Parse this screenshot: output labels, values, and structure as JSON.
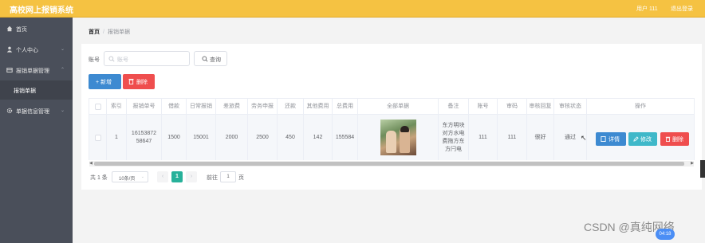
{
  "header": {
    "title": "高校网上报销系统",
    "user": "用户 111",
    "logout": "退出登录"
  },
  "sidebar": {
    "items": [
      {
        "label": "首页",
        "icon": "home-icon"
      },
      {
        "label": "个人中心",
        "icon": "user-icon"
      },
      {
        "label": "报销单据管理",
        "icon": "wallet-icon"
      },
      {
        "label": "报销单据",
        "sub": true
      },
      {
        "label": "单据信息管理",
        "icon": "gear-icon"
      }
    ]
  },
  "breadcrumb": {
    "home": "首页",
    "separator": "/",
    "current": "报销单据"
  },
  "search": {
    "label": "账号",
    "placeholder": "账号",
    "button": "查询"
  },
  "toolbar": {
    "add": "+ 新增",
    "delete": "删除"
  },
  "table": {
    "headers": [
      "索引",
      "报销单号",
      "借款",
      "日常报销",
      "差旅费",
      "劳务申报",
      "还款",
      "其他费用",
      "总费用",
      "全部单据",
      "备注",
      "账号",
      "审码",
      "审核回复",
      "审核状态",
      "操作"
    ],
    "rows": [
      {
        "index": "1",
        "number": "1615387258647",
        "loan": "1500",
        "daily": "15001",
        "travel": "2000",
        "labor": "2500",
        "repay": "450",
        "other": "142",
        "total": "155584",
        "remark": "东方明块对方水电费拖方东方闩电",
        "account": "111",
        "code": "111",
        "reply": "很好",
        "status": "通过"
      }
    ],
    "actions": {
      "detail": "详情",
      "edit": "修改",
      "delete": "删除"
    }
  },
  "pagination": {
    "total": "共 1 条",
    "page_size": "10条/页",
    "current_page": "1",
    "goto": "前往",
    "goto_value": "1",
    "page_suffix": "页"
  },
  "overlay": {
    "watermark": "CSDN @真纯网络",
    "bubble": "04:18"
  },
  "colors": {
    "header": "#f5c242",
    "sidebar": "#4a4f5a",
    "primary": "#3d8ad1",
    "danger": "#ef4e4e",
    "info": "#3fb8c9",
    "pager_active": "#27b19a"
  }
}
